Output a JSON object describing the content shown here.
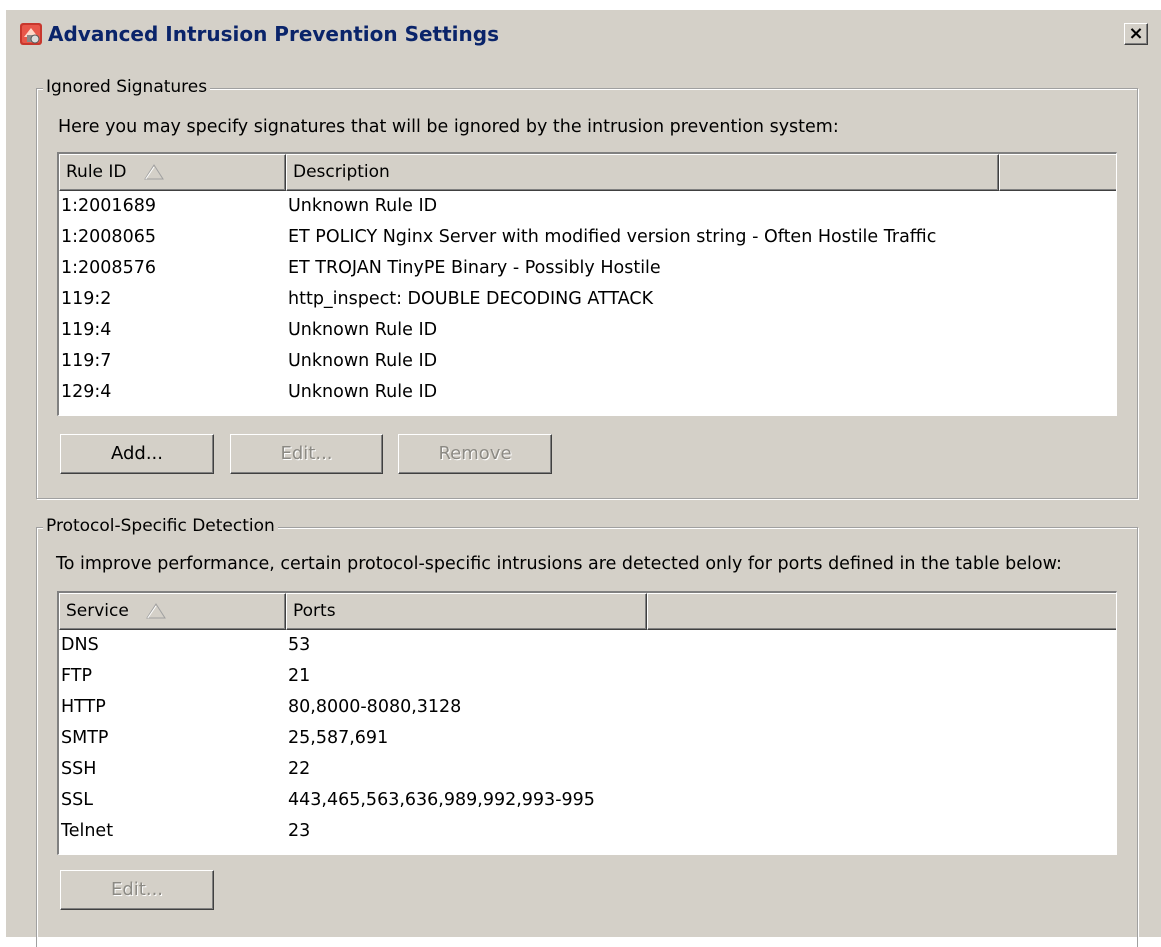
{
  "window": {
    "title": "Advanced Intrusion Prevention Settings",
    "close_label": "×"
  },
  "ignored_signatures": {
    "legend": "Ignored Signatures",
    "description": "Here you may specify signatures that will be ignored by the intrusion prevention system:",
    "columns": [
      "Rule ID",
      "Description",
      ""
    ],
    "sort_column": "Rule ID",
    "rows": [
      {
        "rule_id": "1:2001689",
        "description": "Unknown Rule ID"
      },
      {
        "rule_id": "1:2008065",
        "description": "ET POLICY Nginx Server with modified version string - Often Hostile Traffic"
      },
      {
        "rule_id": "1:2008576",
        "description": "ET TROJAN TinyPE Binary - Possibly Hostile"
      },
      {
        "rule_id": "119:2",
        "description": "http_inspect: DOUBLE DECODING ATTACK"
      },
      {
        "rule_id": "119:4",
        "description": "Unknown Rule ID"
      },
      {
        "rule_id": "119:7",
        "description": "Unknown Rule ID"
      },
      {
        "rule_id": "129:4",
        "description": "Unknown Rule ID"
      }
    ],
    "buttons": {
      "add": "Add...",
      "edit": "Edit...",
      "remove": "Remove"
    }
  },
  "protocol_detection": {
    "legend": "Protocol-Specific Detection",
    "description": "To improve performance, certain protocol-specific intrusions are detected only for ports defined in the table below:",
    "columns": [
      "Service",
      "Ports",
      ""
    ],
    "sort_column": "Service",
    "rows": [
      {
        "service": "DNS",
        "ports": "53"
      },
      {
        "service": "FTP",
        "ports": "21"
      },
      {
        "service": "HTTP",
        "ports": "80,8000-8080,3128"
      },
      {
        "service": "SMTP",
        "ports": "25,587,691"
      },
      {
        "service": "SSH",
        "ports": "22"
      },
      {
        "service": "SSL",
        "ports": "443,465,563,636,989,992,993-995"
      },
      {
        "service": "Telnet",
        "ports": "23"
      }
    ],
    "buttons": {
      "edit": "Edit..."
    }
  },
  "colors": {
    "dialog_bg": "#d4d0c8",
    "title_text": "#0a246a",
    "disabled_text": "#8c8a84"
  }
}
